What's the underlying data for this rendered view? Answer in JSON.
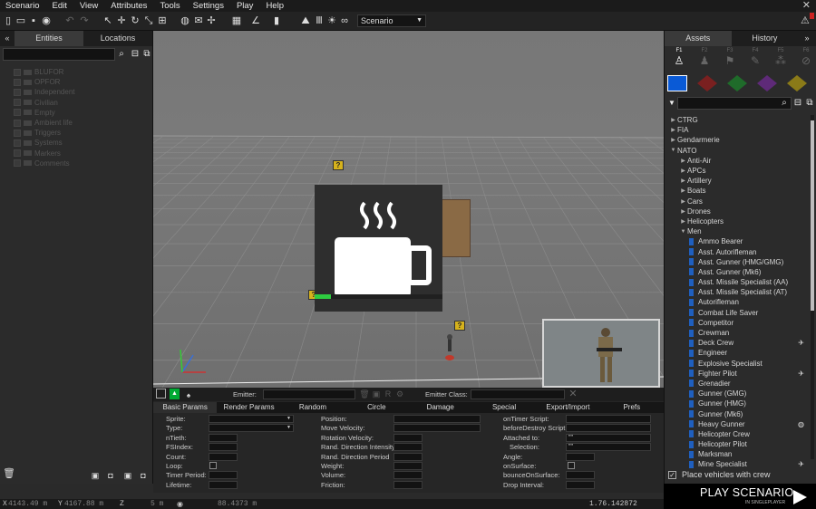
{
  "menu": [
    "Scenario",
    "Edit",
    "View",
    "Attributes",
    "Tools",
    "Settings",
    "Play",
    "Help"
  ],
  "toolbar": {
    "scenario_select": "Scenario"
  },
  "left_panel": {
    "tabs": [
      "Entities",
      "Locations"
    ],
    "tree": [
      "BLUFOR",
      "OPFOR",
      "Independent",
      "Civilian",
      "Empty",
      "Ambient life",
      "Triggers",
      "Systems",
      "Markers",
      "Comments"
    ]
  },
  "right_panel": {
    "tabs": [
      "Assets",
      "History"
    ],
    "faction_tabs": [
      "F1",
      "F2",
      "F3",
      "F4",
      "F5",
      "F6"
    ],
    "sides": [
      {
        "color": "#0a5ad6",
        "active": true
      },
      {
        "color": "#7a2020",
        "active": false
      },
      {
        "color": "#1f6b2a",
        "active": false
      },
      {
        "color": "#5e2a78",
        "active": false
      },
      {
        "color": "#8a7a18",
        "active": false
      }
    ],
    "tree": [
      {
        "label": "CTRG",
        "level": 0,
        "toggle": "▶"
      },
      {
        "label": "FIA",
        "level": 0,
        "toggle": "▶"
      },
      {
        "label": "Gendarmerie",
        "level": 0,
        "toggle": "▶"
      },
      {
        "label": "NATO",
        "level": 0,
        "toggle": "▼"
      },
      {
        "label": "Anti-Air",
        "level": 1,
        "toggle": "▶"
      },
      {
        "label": "APCs",
        "level": 1,
        "toggle": "▶"
      },
      {
        "label": "Artillery",
        "level": 1,
        "toggle": "▶"
      },
      {
        "label": "Boats",
        "level": 1,
        "toggle": "▶"
      },
      {
        "label": "Cars",
        "level": 1,
        "toggle": "▶"
      },
      {
        "label": "Drones",
        "level": 1,
        "toggle": "▶"
      },
      {
        "label": "Helicopters",
        "level": 1,
        "toggle": "▶"
      },
      {
        "label": "Men",
        "level": 1,
        "toggle": "▼"
      },
      {
        "label": "Ammo Bearer",
        "level": 2
      },
      {
        "label": "Asst. Autorifleman",
        "level": 2
      },
      {
        "label": "Asst. Gunner (HMG/GMG)",
        "level": 2
      },
      {
        "label": "Asst. Gunner (Mk6)",
        "level": 2
      },
      {
        "label": "Asst. Missile Specialist (AA)",
        "level": 2
      },
      {
        "label": "Asst. Missile Specialist (AT)",
        "level": 2
      },
      {
        "label": "Autorifleman",
        "level": 2
      },
      {
        "label": "Combat Life Saver",
        "level": 2
      },
      {
        "label": "Competitor",
        "level": 2
      },
      {
        "label": "Crewman",
        "level": 2
      },
      {
        "label": "Deck Crew",
        "level": 2,
        "icon": "✈"
      },
      {
        "label": "Engineer",
        "level": 2
      },
      {
        "label": "Explosive Specialist",
        "level": 2
      },
      {
        "label": "Fighter Pilot",
        "level": 2,
        "icon": "✈"
      },
      {
        "label": "Grenadier",
        "level": 2
      },
      {
        "label": "Gunner (GMG)",
        "level": 2
      },
      {
        "label": "Gunner (HMG)",
        "level": 2
      },
      {
        "label": "Gunner (Mk6)",
        "level": 2
      },
      {
        "label": "Heavy Gunner",
        "level": 2,
        "icon": "◍"
      },
      {
        "label": "Helicopter Crew",
        "level": 2
      },
      {
        "label": "Helicopter Pilot",
        "level": 2
      },
      {
        "label": "Marksman",
        "level": 2
      },
      {
        "label": "Mine Specialist",
        "level": 2,
        "icon": "✈"
      }
    ],
    "place_vehicles": "Place vehicles with crew"
  },
  "play": {
    "title": "PLAY SCENARIO",
    "subtitle": "IN SINGLEPLAYER"
  },
  "loading": {
    "progress": 0.13
  },
  "attributes": {
    "emitter_label": "Emitter:",
    "emitter_class_label": "Emitter Class:",
    "tabs": [
      "Basic Params",
      "Render Params",
      "Random",
      "Circle",
      "Damage",
      "Special",
      "Export/Import",
      "Prefs"
    ],
    "col1": [
      "Sprite:",
      "Type:",
      "nTieth:",
      "FSIndex:",
      "Count:",
      "Loop:",
      "Timer Period:",
      "Lifetime:"
    ],
    "col2": [
      "Position:",
      "Move Velocity:",
      "Rotation Velocity:",
      "Rand. Direction Intensity:",
      "Rand. Direction Period",
      "Weight:",
      "Volume:",
      "Friction:"
    ],
    "col3": [
      "onTimer Script:",
      "beforeDestroy Script:",
      "Attached to:",
      "Selection:",
      "Angle:",
      "onSurface:",
      "bounceOnSurface:",
      "Drop Interval:"
    ],
    "col3_values": [
      "",
      "",
      "\"\"",
      "\"\"",
      "",
      "",
      "",
      ""
    ]
  },
  "status": {
    "x_label": "X",
    "x": "4143.49 m",
    "y_label": "Y",
    "y": "4167.88 m",
    "z_label": "Z",
    "z": "5 m",
    "view": "88.4373 m",
    "version": "1.76.142872"
  }
}
